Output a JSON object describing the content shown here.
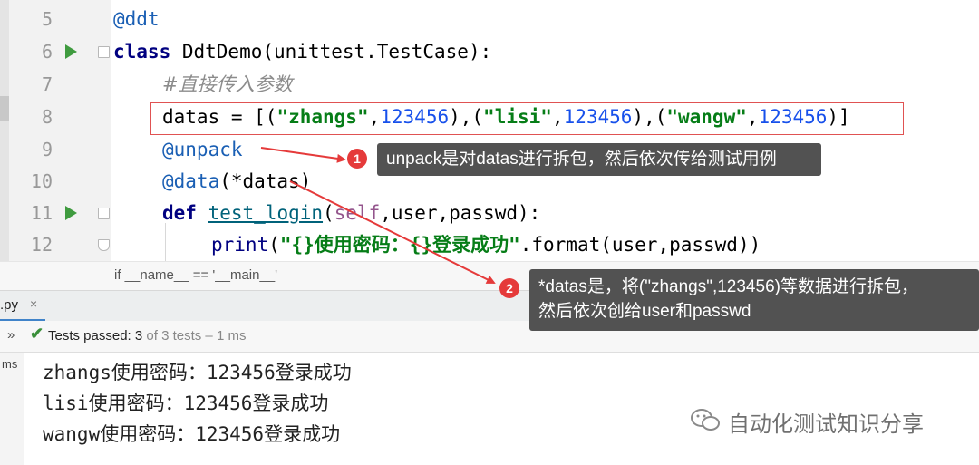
{
  "editor": {
    "lines": [
      {
        "num": "5"
      },
      {
        "num": "6"
      },
      {
        "num": "7"
      },
      {
        "num": "8"
      },
      {
        "num": "9"
      },
      {
        "num": "10"
      },
      {
        "num": "11"
      },
      {
        "num": "12"
      }
    ],
    "code": {
      "l5_decorator": "@ddt",
      "l6_kw": "class",
      "l6_rest": " DdtDemo(unittest.TestCase):",
      "l7_comment": "#直接传入参数",
      "l8_a": "datas = [(",
      "l8_s1": "\"zhangs\"",
      "l8_c1": ",",
      "l8_n1": "123456",
      "l8_b": "),(",
      "l8_s2": "\"lisi\"",
      "l8_c2": ",",
      "l8_n2": "123456",
      "l8_c": "),(",
      "l8_s3": "\"wangw\"",
      "l8_c3": ",",
      "l8_n3": "123456",
      "l8_d": ")]",
      "l9_decorator": "@unpack",
      "l10_decorator": "@data",
      "l10_rest": "(*datas)",
      "l11_kw": "def",
      "l11_fn": "test_login",
      "l11_a": "(",
      "l11_self": "self",
      "l11_b": ",user,passwd):",
      "l12_print": "print",
      "l12_a": "(",
      "l12_str": "\"{}使用密码：{}登录成功\"",
      "l12_b": ".format(user,passwd))"
    },
    "breadcrumb": "if __name__ == '__main__'"
  },
  "run_panel": {
    "tab_label": ".py",
    "tab_close": "×",
    "status_chevron": "»",
    "status_prefix": "Tests passed: ",
    "status_passed": "3",
    "status_suffix": " of 3 tests – 1 ms",
    "side_label": "ms",
    "output": [
      "zhangs使用密码：123456登录成功",
      "lisi使用密码：123456登录成功",
      "wangw使用密码：123456登录成功"
    ]
  },
  "annotations": [
    {
      "badge": "1",
      "text": "unpack是对datas进行拆包，然后依次传给测试用例"
    },
    {
      "badge": "2",
      "text_line1": "*datas是，将(\"zhangs\",123456)等数据进行拆包，",
      "text_line2": "然后依次创给user和passwd"
    }
  ],
  "watermark": "自动化测试知识分享",
  "colors": {
    "arrow": "#e53a3a",
    "run_icon": "#3f9b3f",
    "badge": "#e53a3a",
    "callout_bg": "#525252"
  }
}
